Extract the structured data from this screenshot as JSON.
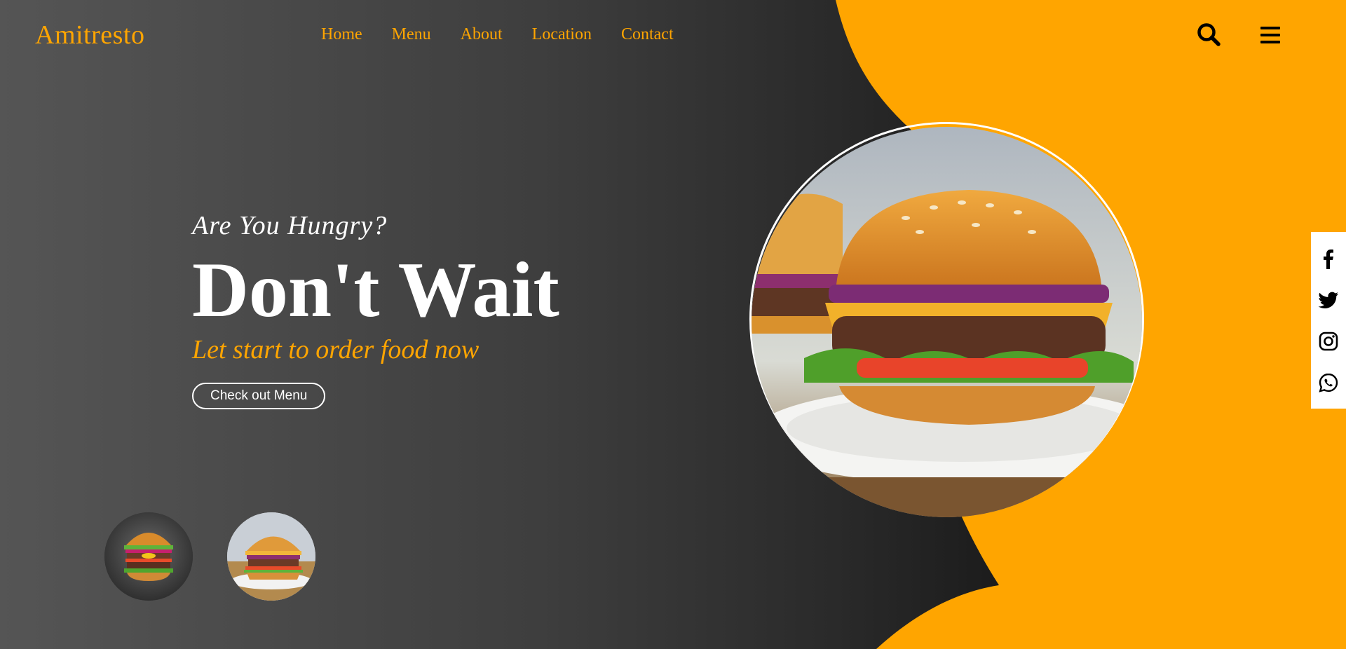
{
  "brand": {
    "name": "Amitresto"
  },
  "nav": {
    "links": [
      {
        "label": "Home"
      },
      {
        "label": "Menu"
      },
      {
        "label": "About"
      },
      {
        "label": "Location"
      },
      {
        "label": "Contact"
      }
    ],
    "search_icon": "search-icon",
    "menu_icon": "hamburger-icon"
  },
  "hero": {
    "kicker": "Are You Hungry?",
    "headline": "Don't Wait",
    "tagline": "Let start to order food now",
    "cta_label": "Check out Menu",
    "main_image": "burger-plate-image",
    "thumbnails": [
      "burger-stack-thumbnail",
      "burger-plate-thumbnail"
    ]
  },
  "social": {
    "icons": [
      "facebook-icon",
      "twitter-icon",
      "instagram-icon",
      "whatsapp-icon"
    ]
  },
  "colors": {
    "accent": "#ffa500",
    "background_dark": "#1b1b1b",
    "text": "#ffffff"
  }
}
